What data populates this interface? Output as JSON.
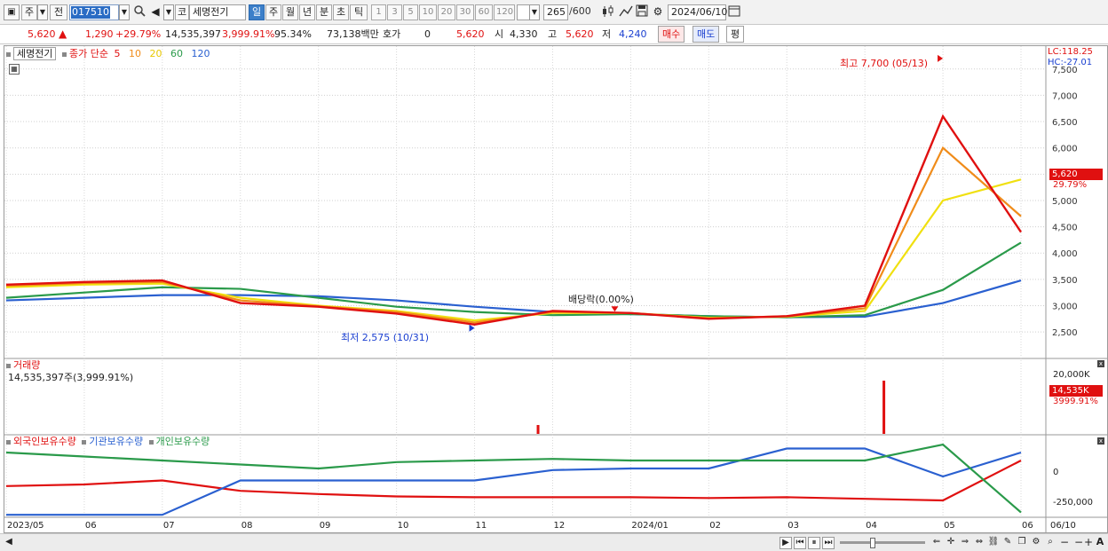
{
  "toolbar": {
    "market": "주",
    "prev": "전",
    "code": "017510",
    "market_btn": "코",
    "stock_name": "세명전기",
    "periods": [
      "일",
      "주",
      "월",
      "년",
      "분",
      "초",
      "틱"
    ],
    "active_period": "일",
    "intervals": [
      "1",
      "3",
      "5",
      "10",
      "20",
      "30",
      "60",
      "120"
    ],
    "count": "265",
    "count_total": "/600",
    "date": "2024/06/10"
  },
  "quote": {
    "price": "5,620",
    "change": "1,290",
    "change_pct": "+29.79%",
    "volume": "14,535,397",
    "volume_pct": "3,999.91%",
    "ratio": "95.34%",
    "amount": "73,138백만",
    "hoga_label": "호가",
    "hoga_value": "0",
    "hoga_price": "5,620",
    "open_label": "시",
    "open": "4,330",
    "high_label": "고",
    "high": "5,620",
    "low_label": "저",
    "low": "4,240",
    "buy_label": "매수",
    "sell_label": "매도",
    "eval_label": "평"
  },
  "legend": {
    "name": "세명전기",
    "ma_label": "종가 단순",
    "ma_periods": [
      {
        "label": "5",
        "color": "#e01010"
      },
      {
        "label": "10",
        "color": "#f08c1a"
      },
      {
        "label": "20",
        "color": "#f0e010"
      },
      {
        "label": "60",
        "color": "#2a9a4a"
      },
      {
        "label": "120",
        "color": "#2a60d0"
      }
    ]
  },
  "price_panel": {
    "lc": "LC:118.25",
    "hc": "HC:-27.01",
    "y_ticks": [
      "7,500",
      "7,000",
      "6,500",
      "6,000",
      "5,500",
      "5,000",
      "4,500",
      "4,000",
      "3,500",
      "3,000",
      "2,500"
    ],
    "high_note": "최고 7,700 (05/13)",
    "low_note": "최저 2,575 (10/31)",
    "dividend_note": "배당락(0.00%)",
    "current_price": "5,620",
    "current_pct": "29.79%"
  },
  "volume_panel": {
    "title": "거래량",
    "value": "14,535,397주(3,999.91%)",
    "y_tick": "20,000K",
    "current": "14,535K",
    "current_pct": "3999.91%"
  },
  "holding_panel": {
    "series": [
      {
        "name": "외국인보유수량",
        "color": "#e01010"
      },
      {
        "name": "기관보유수량",
        "color": "#2a60d0"
      },
      {
        "name": "개인보유수량",
        "color": "#2a9a4a"
      }
    ],
    "y_ticks": [
      "0",
      "-250,000"
    ]
  },
  "x_axis": [
    "2023/05",
    "06",
    "07",
    "08",
    "09",
    "10",
    "11",
    "12",
    "2024/01",
    "02",
    "03",
    "04",
    "05",
    "06",
    "06/10"
  ],
  "chart_data": {
    "type": "line",
    "x": [
      "2023/05",
      "06",
      "07",
      "08",
      "09",
      "10",
      "11",
      "12",
      "2024/01",
      "02",
      "03",
      "04",
      "05",
      "06"
    ],
    "series": [
      {
        "name": "5",
        "values": [
          3400,
          3450,
          3480,
          3050,
          2980,
          2850,
          2640,
          2900,
          2860,
          2750,
          2800,
          3000,
          6600,
          4400
        ]
      },
      {
        "name": "10",
        "values": [
          3380,
          3430,
          3450,
          3100,
          2990,
          2880,
          2680,
          2880,
          2860,
          2760,
          2800,
          2950,
          6000,
          4700
        ]
      },
      {
        "name": "20",
        "values": [
          3350,
          3400,
          3420,
          3150,
          3000,
          2900,
          2720,
          2860,
          2860,
          2770,
          2790,
          2900,
          5000,
          5400
        ]
      },
      {
        "name": "60",
        "values": [
          3150,
          3250,
          3350,
          3320,
          3150,
          2980,
          2880,
          2820,
          2840,
          2800,
          2780,
          2820,
          3300,
          4200
        ]
      },
      {
        "name": "120",
        "values": [
          3100,
          3150,
          3200,
          3200,
          3180,
          3100,
          2980,
          2880,
          2840,
          2800,
          2780,
          2790,
          3050,
          3480
        ]
      }
    ],
    "ylim": [
      2300,
      7800
    ],
    "volume_x": [
      "11",
      "05"
    ],
    "y_axis_right": true
  }
}
